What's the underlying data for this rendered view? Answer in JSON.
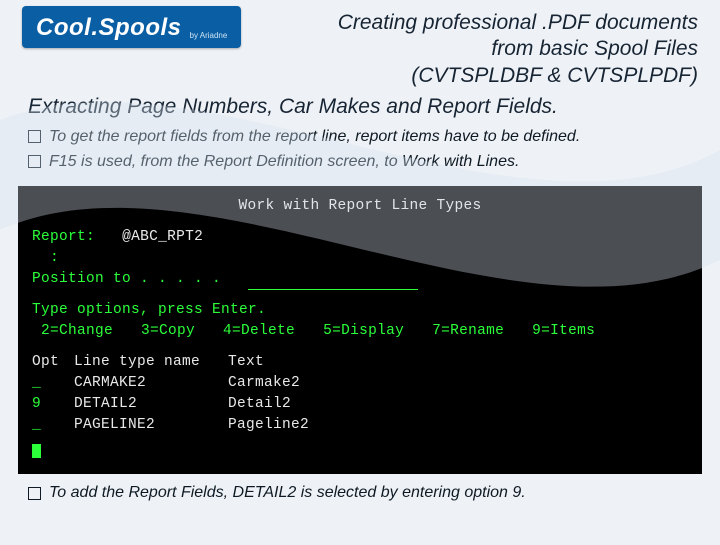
{
  "logo": {
    "brand_a": "Cool.",
    "brand_b": "Spools",
    "byline": "by Ariadne"
  },
  "title": {
    "line1": "Creating professional .PDF documents",
    "line2": "from basic Spool Files",
    "line3": "(CVTSPLDBF & CVTSPLPDF)"
  },
  "subtitle": "Extracting Page Numbers, Car Makes and Report Fields.",
  "bullets": [
    "To get the report fields from the report line, report items have to be defined.",
    "F15 is used, from the Report Definition screen, to Work with Lines."
  ],
  "terminal": {
    "screen_title": "Work with Report Line Types",
    "report_label": "Report:",
    "report_value": "@ABC_RPT2",
    "position_label": "Position to . . . . .",
    "instruct": "Type options, press Enter.",
    "options": [
      "2=Change",
      "3=Copy",
      "4=Delete",
      "5=Display",
      "7=Rename",
      "9=Items"
    ],
    "col_opt": "Opt",
    "col_name": "Line type name",
    "col_text": "Text",
    "rows": [
      {
        "opt": "_",
        "name": "CARMAKE2",
        "text": "Carmake2"
      },
      {
        "opt": "9",
        "name": "DETAIL2",
        "text": "Detail2"
      },
      {
        "opt": "_",
        "name": "PAGELINE2",
        "text": "Pageline2"
      }
    ]
  },
  "footer": "To add the Report Fields, DETAIL2 is selected by entering option 9."
}
